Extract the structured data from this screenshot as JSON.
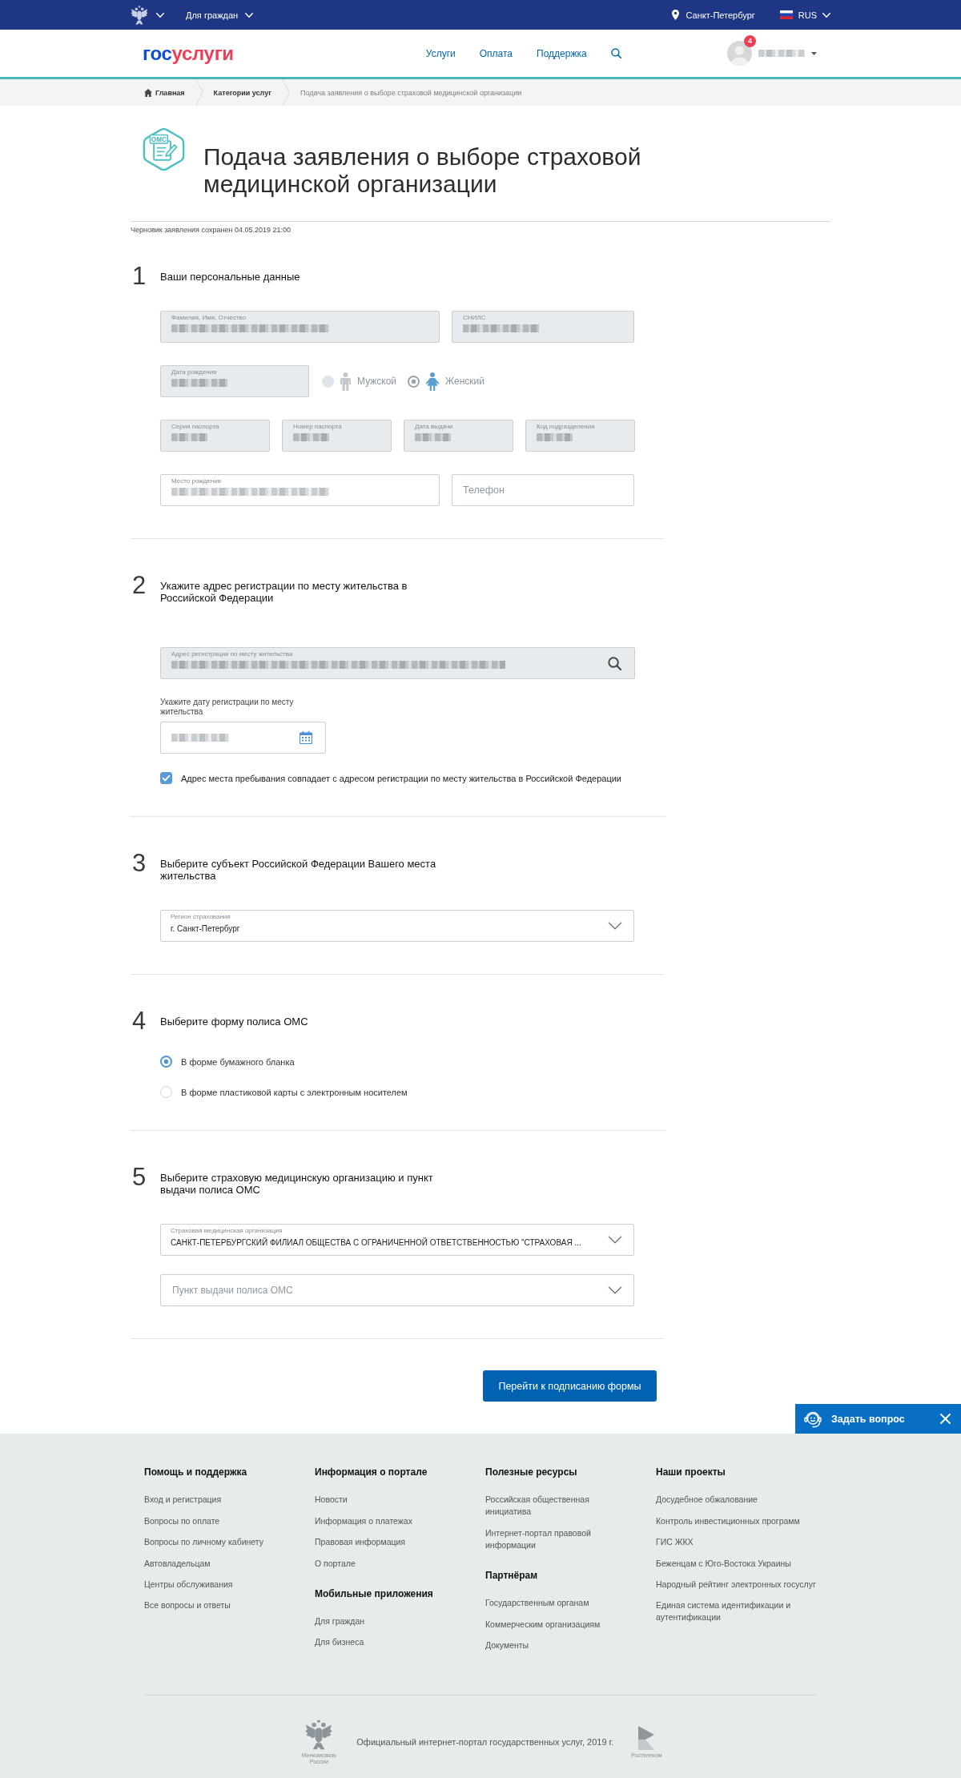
{
  "top_bar": {
    "audience": "Для граждан",
    "city": "Санкт-Петербург",
    "language": "RUS"
  },
  "header": {
    "logo": {
      "first": "гос",
      "second": "услуги"
    },
    "nav": [
      "Услуги",
      "Оплата",
      "Поддержка"
    ],
    "user": {
      "notifications": "4",
      "name_redacted": true
    }
  },
  "breadcrumbs": [
    {
      "kind": "home",
      "label": "Главная"
    },
    {
      "kind": "link",
      "label": "Категории услуг"
    },
    {
      "kind": "current",
      "label": "Подача заявления о выборе страховой медицинской организации"
    }
  ],
  "page": {
    "icon_label": "ОМС",
    "title": "Подача заявления о выборе страховой медицинской организации",
    "draft_note": "Черновик заявления сохранен 04.05.2019 21:00"
  },
  "sections": [
    {
      "number": "1",
      "heading": "Ваши персональные данные",
      "rows": [
        {
          "kind": "pair",
          "fields": [
            {
              "label": "Фамилия, Имя, Отчество",
              "disabled": true,
              "redacted": true
            },
            {
              "label": "СНИЛС",
              "disabled": true,
              "redacted": true
            }
          ]
        },
        {
          "kind": "birth_gender",
          "disabled": true,
          "fields": [
            {
              "label": "Дата рождения",
              "disabled": true,
              "redacted": true
            }
          ],
          "options": [
            {
              "kind": "male",
              "label": "Мужской",
              "selected": false
            },
            {
              "kind": "female",
              "label": "Женский",
              "selected": true
            }
          ]
        },
        {
          "kind": "quad",
          "fields": [
            {
              "label": "Серия паспорта",
              "disabled": true,
              "redacted": true
            },
            {
              "label": "Номер паспорта",
              "disabled": true,
              "redacted": true
            },
            {
              "label": "Дата выдачи",
              "disabled": true,
              "redacted": true
            },
            {
              "label": "Код подразделения",
              "disabled": true,
              "redacted": true
            }
          ]
        },
        {
          "kind": "pair",
          "fields": [
            {
              "label": "Место рождения",
              "disabled": false,
              "redacted": true
            },
            {
              "placeholder": "Телефон",
              "disabled": false
            }
          ]
        }
      ]
    },
    {
      "number": "2",
      "heading": "Укажите адрес регистрации по месту жительства в Российской Федерации",
      "rows": [
        {
          "kind": "search",
          "fields": [
            {
              "label": "Адрес регистрации по месту жительства",
              "disabled": true,
              "redacted": true
            }
          ]
        },
        {
          "kind": "date",
          "caption": "Укажите дату регистрации по месту жительства",
          "fields": [
            {
              "disabled": false,
              "redacted": true
            }
          ]
        },
        {
          "kind": "checkbox",
          "label": "Адрес места пребывания совпадает с адресом регистрации по месту жительства в Российской Федерации",
          "checked": true
        }
      ]
    },
    {
      "number": "3",
      "heading": "Выберите субъект Российской Федерации Вашего места жительства",
      "rows": [
        {
          "kind": "select",
          "fields": [
            {
              "label": "Регион страхования",
              "value": "г. Санкт-Петербург",
              "disabled": false
            }
          ]
        }
      ]
    },
    {
      "number": "4",
      "heading": "Выберите форму полиса ОМС",
      "rows": [
        {
          "kind": "radio",
          "options": [
            {
              "label": "В форме бумажного бланка",
              "selected": true
            },
            {
              "label": "В форме пластиковой карты с электронным носителем",
              "selected": false
            }
          ]
        }
      ]
    },
    {
      "number": "5",
      "heading": "Выберите страховую медицинскую организацию и пункт выдачи полиса ОМС",
      "rows": [
        {
          "kind": "select",
          "fields": [
            {
              "label": "Страховая медицинская организация",
              "value": "САНКТ-ПЕТЕРБУРГСКИЙ ФИЛИАЛ ОБЩЕСТВА С ОГРАНИЧЕННОЙ ОТВЕТСТВЕННОСТЬЮ \"СТРАХОВАЯ ...",
              "disabled": false
            }
          ]
        },
        {
          "kind": "select",
          "fields": [
            {
              "placeholder": "Пункт выдачи полиса ОМС",
              "disabled": false
            }
          ]
        }
      ]
    }
  ],
  "submit_button": "Перейти к подписанию формы",
  "chat": {
    "label": "Задать вопрос"
  },
  "footer": {
    "columns": [
      {
        "groups": [
          {
            "heading": "Помощь и поддержка",
            "links": [
              "Вход и регистрация",
              "Вопросы по оплате",
              "Вопросы по личному кабинету",
              "Автовладельцам",
              "Центры обслуживания",
              "Все вопросы и ответы"
            ]
          }
        ]
      },
      {
        "groups": [
          {
            "heading": "Информация о портале",
            "links": [
              "Новости",
              "Информация о платежах",
              "Правовая информация",
              "О портале"
            ]
          },
          {
            "heading": "Мобильные приложения",
            "links": [
              "Для граждан",
              "Для бизнеса"
            ]
          }
        ]
      },
      {
        "groups": [
          {
            "heading": "Полезные ресурсы",
            "links": [
              "Российская общественная инициатива",
              "Интернет-портал правовой информации"
            ]
          },
          {
            "heading": "Партнёрам",
            "links": [
              "Государственным органам",
              "Коммерческим организациям",
              "Документы"
            ]
          }
        ]
      },
      {
        "groups": [
          {
            "heading": "Наши проекты",
            "links": [
              "Досудебное обжалование",
              "Контроль инвестиционных программ",
              "ГИС ЖКХ",
              "Беженцам с Юго-Востока Украины",
              "Народный рейтинг электронных госуслуг",
              "Единая система идентификации и аутентификации"
            ]
          }
        ]
      }
    ],
    "ministry": "Минкомсвязь России",
    "copyright": "Официальный интернет-портал государственных услуг, 2019 г.",
    "operator": "Ростелеком"
  }
}
